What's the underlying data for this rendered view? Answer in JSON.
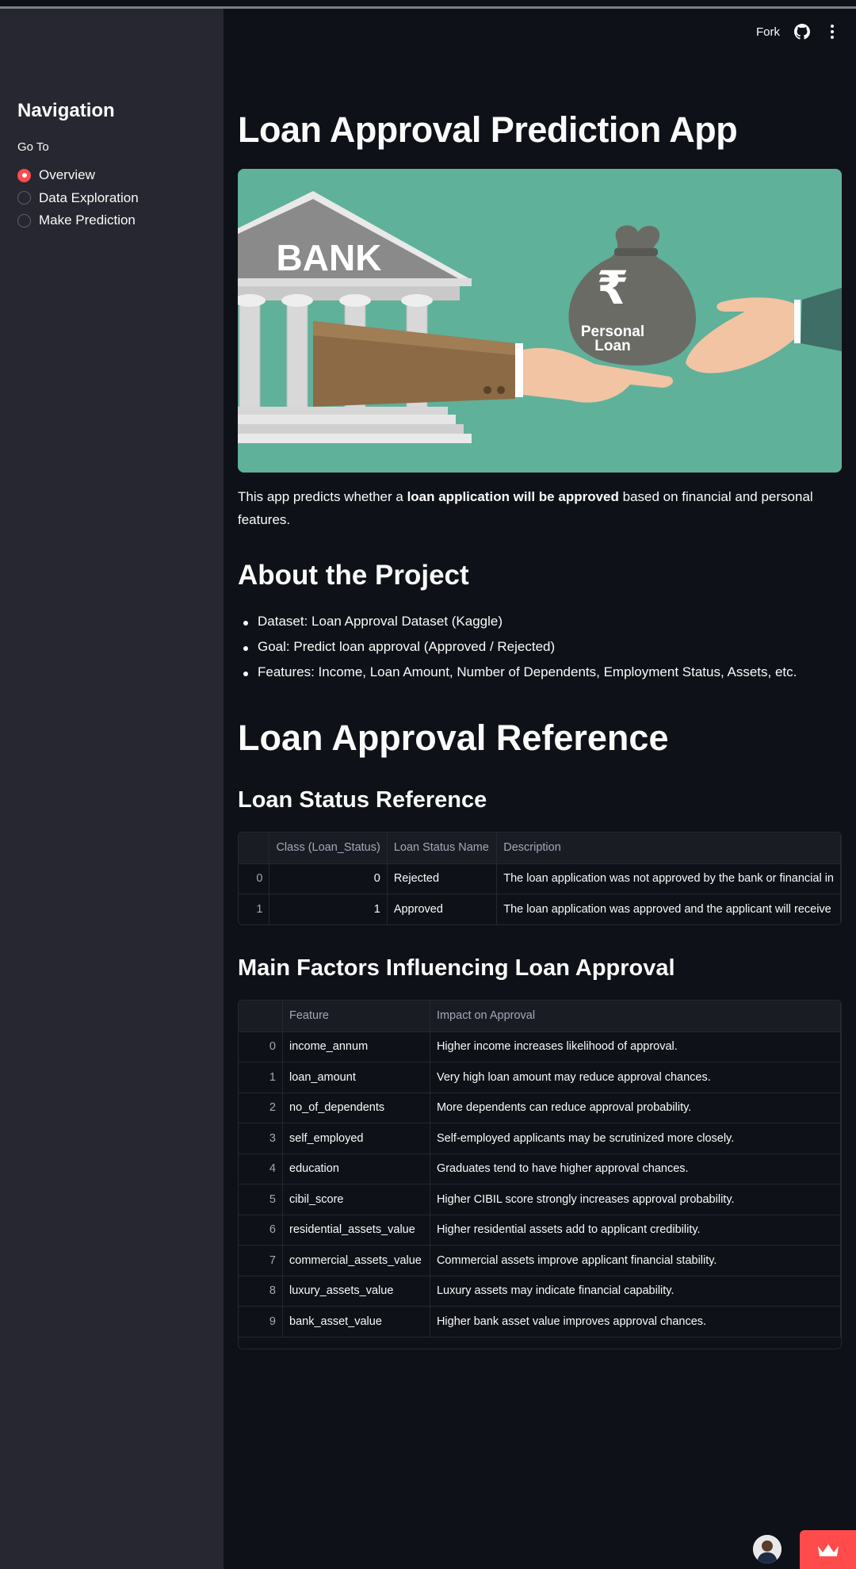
{
  "header": {
    "fork_label": "Fork"
  },
  "sidebar": {
    "title": "Navigation",
    "goto_label": "Go To",
    "options": [
      {
        "label": "Overview",
        "selected": true
      },
      {
        "label": "Data Exploration",
        "selected": false
      },
      {
        "label": "Make Prediction",
        "selected": false
      }
    ]
  },
  "main": {
    "title": "Loan Approval Prediction App",
    "hero_image": {
      "bank_text": "BANK",
      "bag_symbol": "₹",
      "bag_text_1": "Personal",
      "bag_text_2": "Loan"
    },
    "intro_prefix": "This app predicts whether a ",
    "intro_bold": "loan application will be approved",
    "intro_suffix": " based on financial and personal features.",
    "about_heading": "About the Project",
    "about_items": [
      "Dataset: Loan Approval Dataset (Kaggle)",
      "Goal: Predict loan approval (Approved / Rejected)",
      "Features: Income, Loan Amount, Number of Dependents, Employment Status, Assets, etc."
    ],
    "reference_heading": "Loan Approval Reference",
    "status_heading": "Loan Status Reference",
    "status_table": {
      "columns": [
        "",
        "Class (Loan_Status)",
        "Loan Status Name",
        "Description"
      ],
      "rows": [
        [
          "0",
          "0",
          "Rejected",
          "The loan application was not approved by the bank or financial in"
        ],
        [
          "1",
          "1",
          "Approved",
          "The loan application was approved and the applicant will receive"
        ]
      ]
    },
    "factors_heading": "Main Factors Influencing Loan Approval",
    "factors_table": {
      "columns": [
        "",
        "Feature",
        "Impact on Approval"
      ],
      "rows": [
        [
          "0",
          "income_annum",
          "Higher income increases likelihood of approval."
        ],
        [
          "1",
          "loan_amount",
          "Very high loan amount may reduce approval chances."
        ],
        [
          "2",
          "no_of_dependents",
          "More dependents can reduce approval probability."
        ],
        [
          "3",
          "self_employed",
          "Self-employed applicants may be scrutinized more closely."
        ],
        [
          "4",
          "education",
          "Graduates tend to have higher approval chances."
        ],
        [
          "5",
          "cibil_score",
          "Higher CIBIL score strongly increases approval probability."
        ],
        [
          "6",
          "residential_assets_value",
          "Higher residential assets add to applicant credibility."
        ],
        [
          "7",
          "commercial_assets_value",
          "Commercial assets improve applicant financial stability."
        ],
        [
          "8",
          "luxury_assets_value",
          "Luxury assets may indicate financial capability."
        ],
        [
          "9",
          "bank_asset_value",
          "Higher bank asset value improves approval chances."
        ]
      ]
    }
  },
  "colors": {
    "accent": "#ff4b4b",
    "sidebar_bg": "#262730",
    "main_bg": "#0e1117"
  }
}
